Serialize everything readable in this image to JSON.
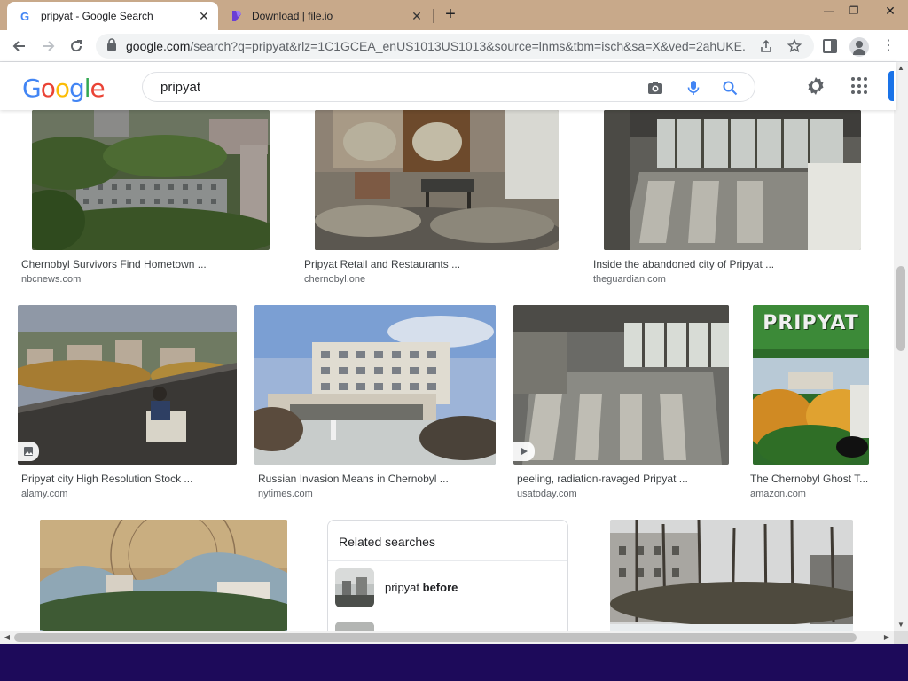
{
  "browser": {
    "tabs": [
      {
        "title": "pripyat - Google Search",
        "active": true
      },
      {
        "title": "Download | file.io",
        "active": false
      }
    ],
    "url_host": "google.com",
    "url_path": "/search?q=pripyat&rlz=1C1GCEA_enUS1013US1013&source=lnms&tbm=isch&sa=X&ved=2ahUKE...",
    "window_controls": {
      "minimize": "—",
      "maximize": "❐",
      "close": "✕"
    }
  },
  "google": {
    "logo_letters": [
      "G",
      "o",
      "o",
      "g",
      "l",
      "e"
    ],
    "query": "pripyat"
  },
  "results": [
    {
      "title": "Chernobyl Survivors Find Hometown ...",
      "source": "nbcnews.com"
    },
    {
      "title": "Pripyat Retail and Restaurants ...",
      "source": "chernobyl.one"
    },
    {
      "title": "Inside the abandoned city of Pripyat ...",
      "source": "theguardian.com"
    },
    {
      "title": "Pripyat city High Resolution Stock ...",
      "source": "alamy.com"
    },
    {
      "title": "Russian Invasion Means in Chernobyl ...",
      "source": "nytimes.com"
    },
    {
      "title": "peeling, radiation-ravaged Pripyat ...",
      "source": "usatoday.com"
    },
    {
      "title": "The Chernobyl Ghost T...",
      "source": "amazon.com"
    }
  ],
  "book_cover_title": "PRIPYAT",
  "related": {
    "heading": "Related searches",
    "items": [
      {
        "prefix": "pripyat ",
        "bold": "before"
      }
    ]
  },
  "colors": {
    "tabstrip": "#c8a98a",
    "taskbar": "#1d0a5a",
    "link_blue": "#1a73e8"
  }
}
